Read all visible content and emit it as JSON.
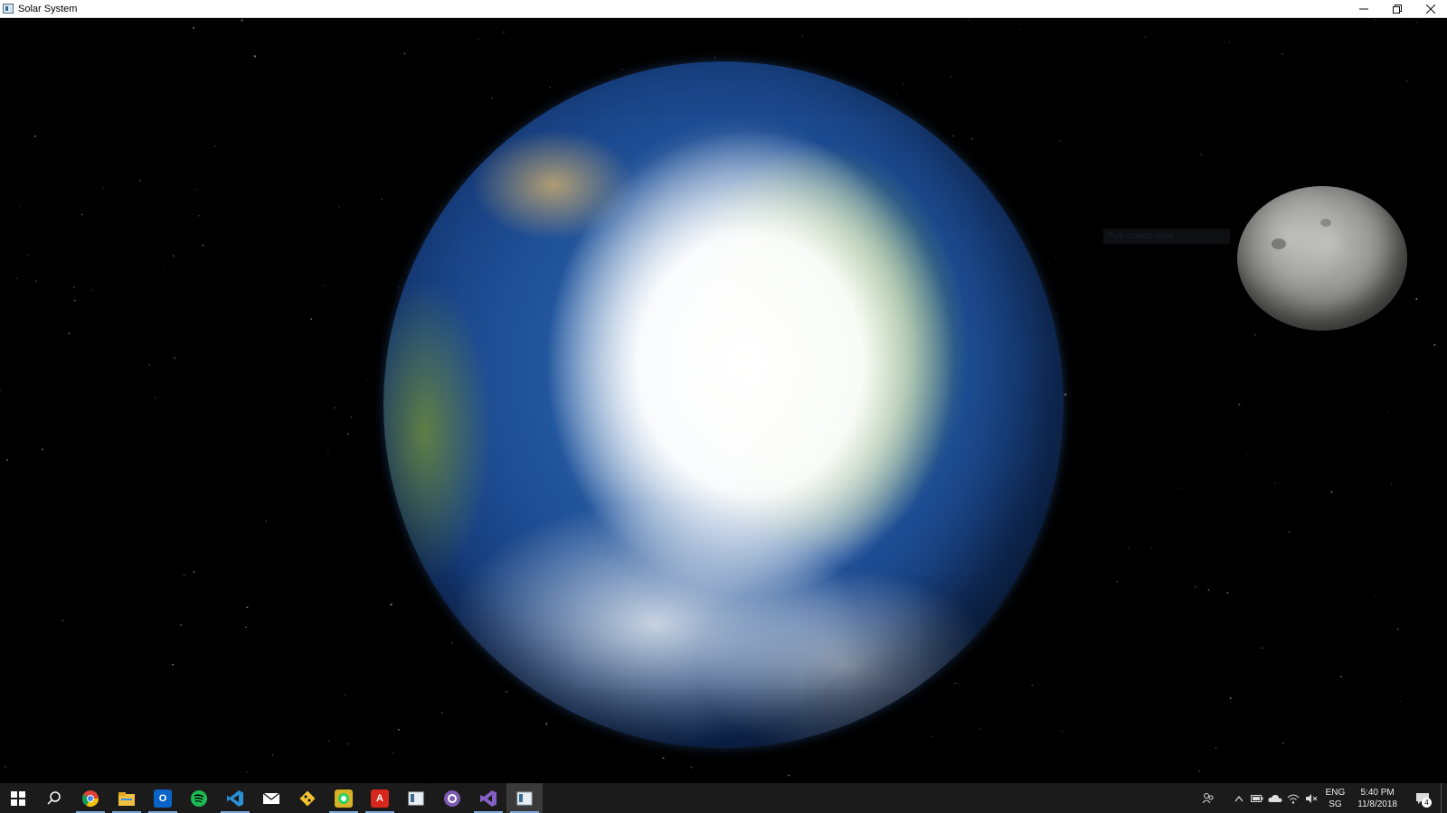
{
  "window": {
    "title": "Solar System",
    "controls": {
      "minimize_glyph": "–",
      "maximize_glyph": "❐",
      "close_glyph": "✕"
    }
  },
  "scene": {
    "background_color": "#000000",
    "bodies": [
      {
        "name_icon": "earth-globe",
        "colors": [
          "#2f6fb6",
          "#ffffff",
          "#7ab428"
        ]
      },
      {
        "name_icon": "moon-sphere",
        "colors": [
          "#b8b8b6",
          "#5e5e5c"
        ]
      }
    ],
    "dim_label": "Full screen orbit"
  },
  "taskbar": {
    "background": "#1b1b1b",
    "apps": [
      {
        "icon": "windows-start-icon",
        "glyph": "⊞"
      },
      {
        "icon": "search-icon",
        "glyph": "⚲"
      },
      {
        "icon": "chrome-icon",
        "glyph": ""
      },
      {
        "icon": "file-explorer-icon",
        "glyph": ""
      },
      {
        "icon": "outlook-icon",
        "glyph": "O"
      },
      {
        "icon": "spotify-icon",
        "glyph": ""
      },
      {
        "icon": "vscode-icon",
        "glyph": "⟩"
      },
      {
        "icon": "mail-icon",
        "glyph": "✉"
      },
      {
        "icon": "git-icon",
        "glyph": "◆"
      },
      {
        "icon": "whatsapp-icon",
        "glyph": "☏"
      },
      {
        "icon": "acrobat-icon",
        "glyph": "A"
      },
      {
        "icon": "app-window-icon",
        "glyph": ""
      },
      {
        "icon": "github-desktop-icon",
        "glyph": ""
      },
      {
        "icon": "visual-studio-icon",
        "glyph": "∞"
      },
      {
        "icon": "solar-system-app-icon",
        "glyph": ""
      }
    ],
    "tray": {
      "language_top": "ENG",
      "language_bottom": "SG",
      "time": "5:40 PM",
      "date": "11/8/2018",
      "notification_count": "4"
    }
  }
}
